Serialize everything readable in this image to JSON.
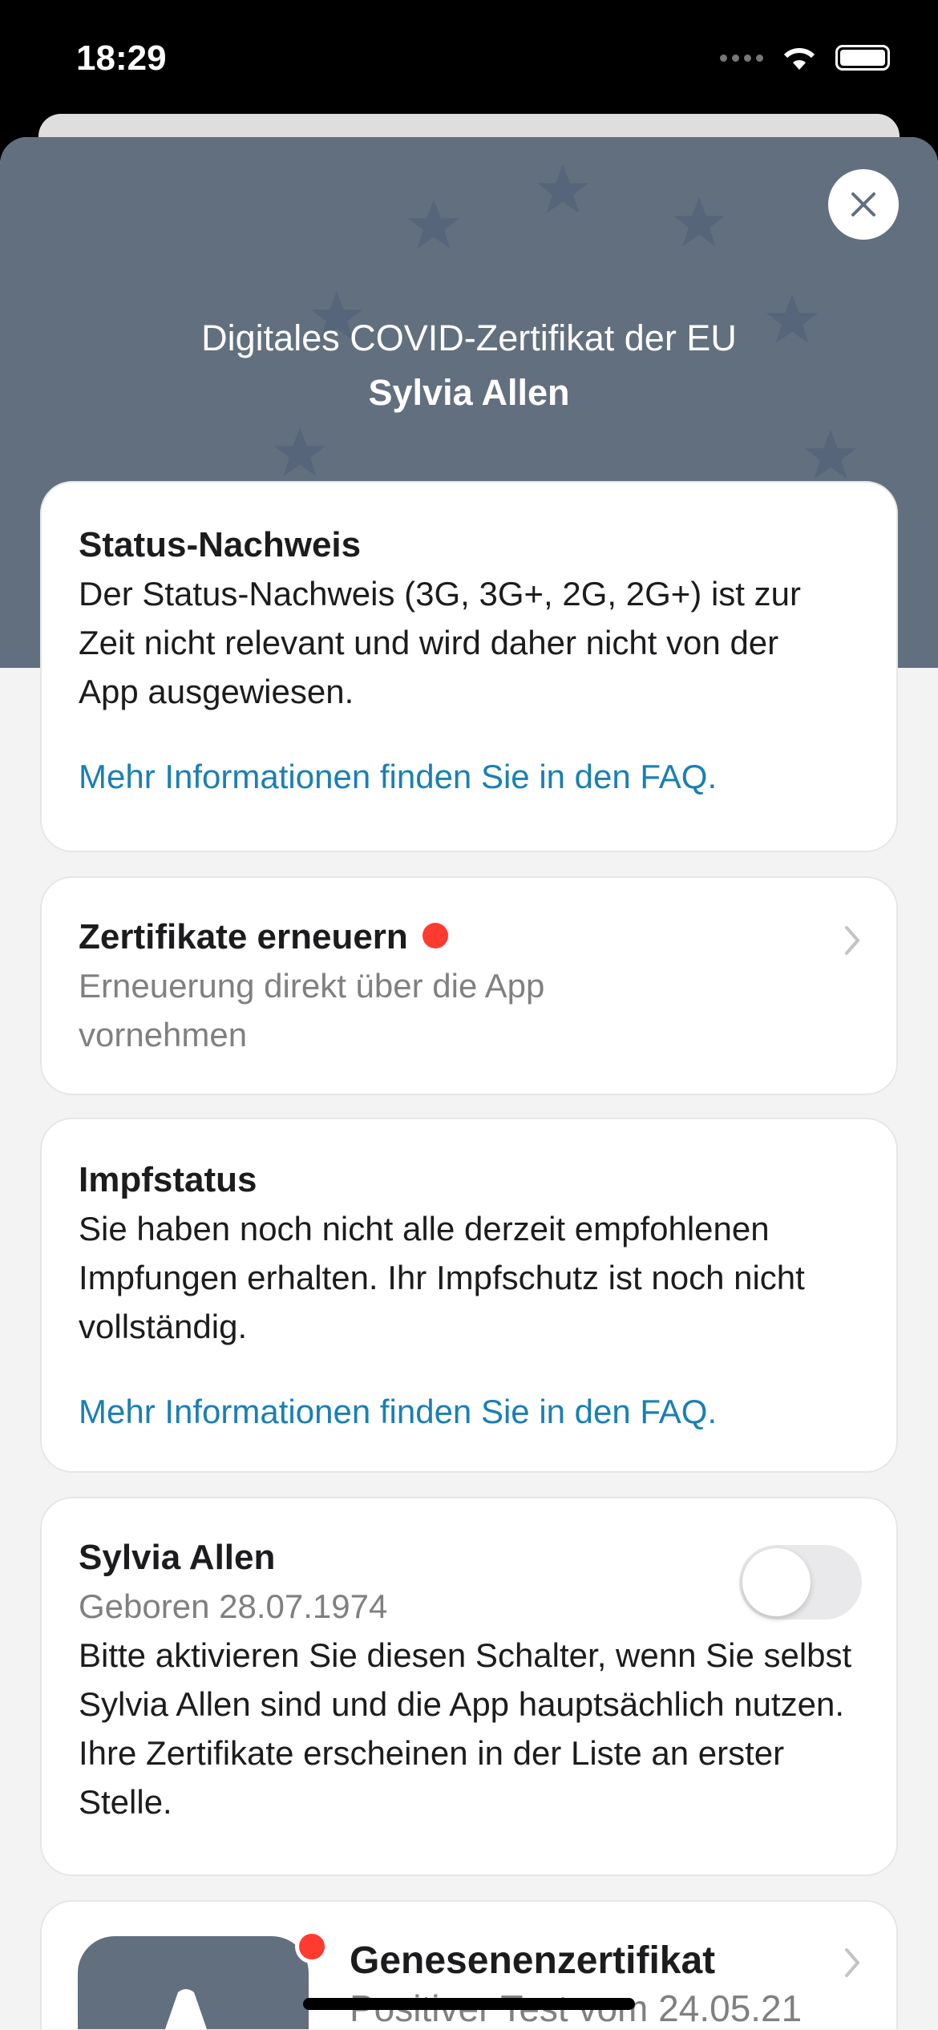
{
  "status_bar": {
    "time": "18:29"
  },
  "header": {
    "title": "Digitales COVID-Zertifikat der EU",
    "name": "Sylvia Allen"
  },
  "status_card": {
    "title": "Status-Nachweis",
    "body": "Der Status-Nachweis (3G, 3G+, 2G, 2G+) ist zur Zeit nicht relevant und wird daher nicht von der App ausgewiesen.",
    "link": "Mehr Informationen finden Sie in den FAQ."
  },
  "renew_card": {
    "title": "Zertifikate erneuern",
    "subtitle": "Erneuerung direkt über die App vornehmen"
  },
  "vaccination_card": {
    "title": "Impfstatus",
    "body": "Sie haben noch nicht alle derzeit empfohlenen Impfungen erhalten. Ihr Impfschutz ist noch nicht vollständig.",
    "link": "Mehr Informationen finden Sie in den FAQ."
  },
  "person_card": {
    "name": "Sylvia Allen",
    "dob": "Geboren 28.07.1974",
    "body": "Bitte aktivieren Sie diesen Schalter, wenn Sie selbst Sylvia Allen sind und die App hauptsächlich nutzen. Ihre Zertifikate erscheinen in der Liste an erster Stelle.",
    "toggle_on": false
  },
  "certificate_card": {
    "title": "Genesenenzertifikat",
    "subtitle": "Positiver Test vom 24.05.21"
  },
  "colors": {
    "header": "#626f7f",
    "link": "#1a7fb5",
    "badge": "#ff3b30"
  }
}
